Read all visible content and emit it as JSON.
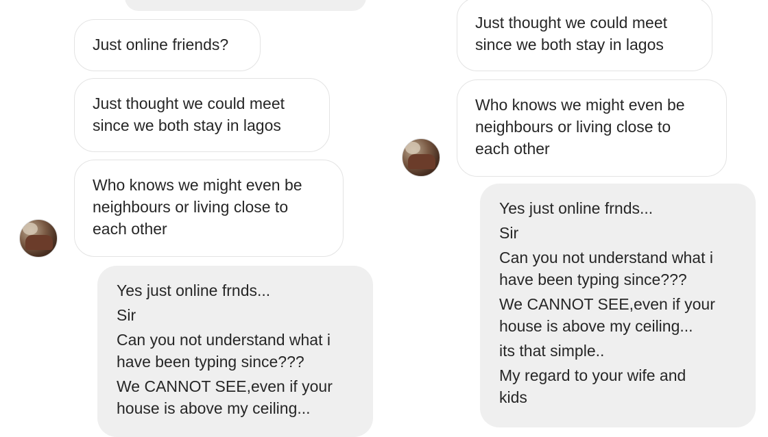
{
  "left_panel": {
    "sent": [
      {
        "lines": [
          "Just online friends?"
        ]
      },
      {
        "lines": [
          "Just thought we could meet",
          "since we both stay in lagos"
        ]
      },
      {
        "lines": [
          "Who knows we might even be",
          "neighbours or living close to",
          "each other"
        ]
      }
    ],
    "reply": {
      "lines": [
        "Yes just online frnds...",
        "Sir",
        "Can you not understand what i",
        "have been typing since???",
        "We CANNOT SEE,even if your",
        "house is above my ceiling..."
      ]
    }
  },
  "right_panel": {
    "sent": [
      {
        "lines": [
          "Just thought we could meet",
          "since we both stay in lagos"
        ]
      },
      {
        "lines": [
          "Who knows we might even be",
          "neighbours or living close to",
          "each other"
        ]
      }
    ],
    "reply": {
      "lines": [
        "Yes just online frnds...",
        "Sir",
        "Can you not understand what i",
        "have been typing since???",
        "We CANNOT SEE,even if your",
        "house is above my ceiling...",
        "its that simple..",
        "My regard to your wife and",
        "kids"
      ]
    }
  }
}
